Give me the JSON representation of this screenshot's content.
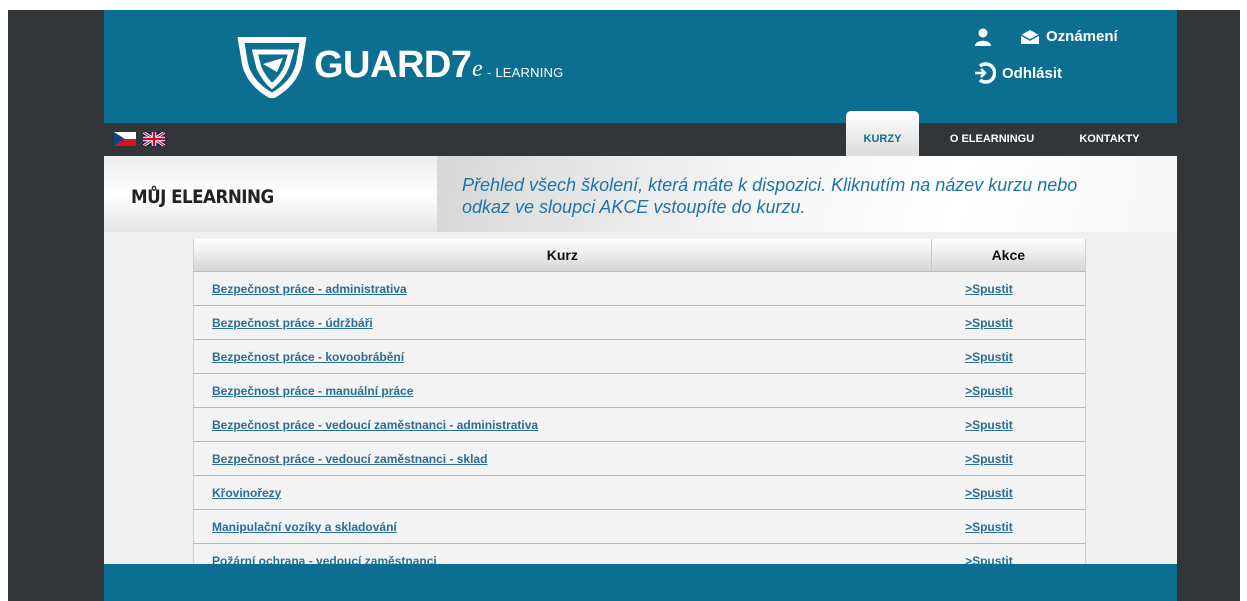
{
  "brand": {
    "name": "GUARD7",
    "e_letter": "e",
    "suffix": "- LEARNING"
  },
  "header": {
    "notifications_label": "Oznámení",
    "logout_label": "Odhlásit",
    "icons": [
      "user-icon",
      "envelope-icon",
      "logout-icon"
    ]
  },
  "languages": [
    "czech-flag",
    "english-flag"
  ],
  "nav": {
    "tabs": [
      {
        "label": "KURZY",
        "active": true
      },
      {
        "label": "O ELEARNINGU",
        "active": false
      },
      {
        "label": "KONTAKTY",
        "active": false
      }
    ]
  },
  "page": {
    "title": "MŮJ ELEARNING",
    "info_line1": "Přehled všech školení, která máte k dispozici. Kliknutím na název kurzu nebo",
    "info_line2": "odkaz ve sloupci AKCE vstoupíte do kurzu."
  },
  "table": {
    "headers": [
      "Kurz",
      "Akce"
    ],
    "rows": [
      {
        "course": "Bezpečnost práce - administrativa",
        "action": ">Spustit"
      },
      {
        "course": "Bezpečnost práce - údržbáři",
        "action": ">Spustit"
      },
      {
        "course": "Bezpečnost práce - kovoobrábění",
        "action": ">Spustit"
      },
      {
        "course": "Bezpečnost práce - manuální práce",
        "action": ">Spustit"
      },
      {
        "course": "Bezpečnost práce - vedoucí zaměstnanci - administrativa",
        "action": ">Spustit"
      },
      {
        "course": "Bezpečnost práce - vedoucí zaměstnanci - sklad",
        "action": ">Spustit"
      },
      {
        "course": "Křovinořezy",
        "action": ">Spustit"
      },
      {
        "course": "Manipulační vozíky a skladování",
        "action": ">Spustit"
      },
      {
        "course": "Požární ochrana - vedoucí zaměstnanci",
        "action": ">Spustit"
      }
    ]
  },
  "colors": {
    "header_blue": "#0c6f91",
    "dark_bar": "#333638",
    "link": "#2a6d95",
    "info_text": "#1e74a6"
  }
}
